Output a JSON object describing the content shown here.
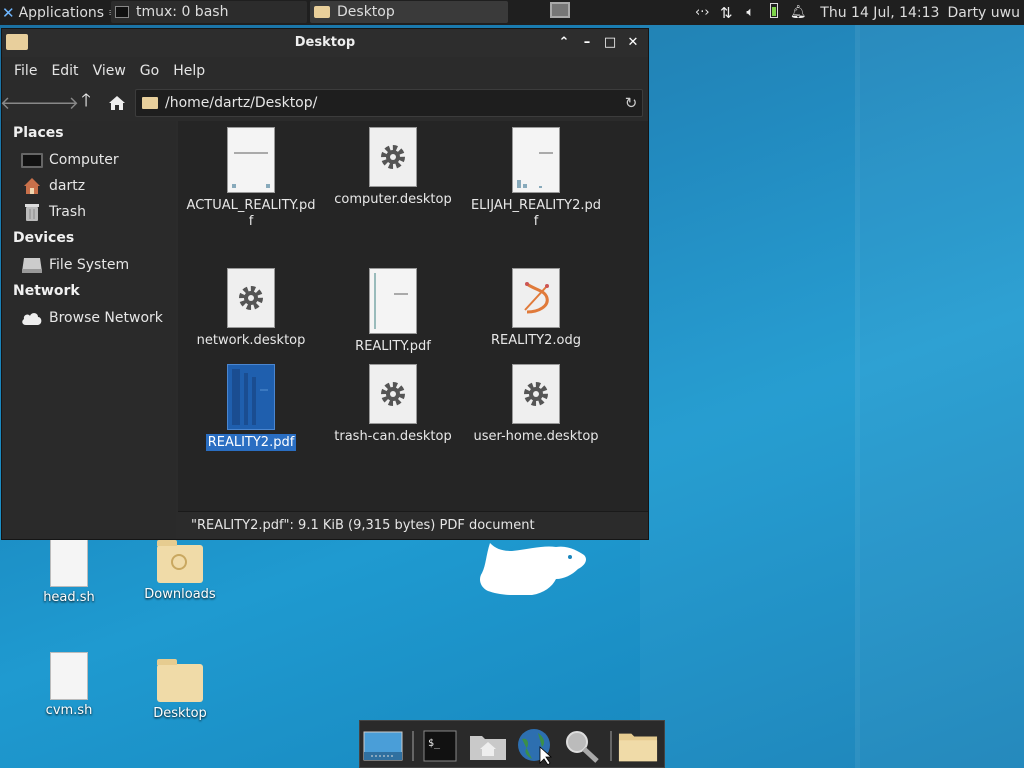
{
  "top_panel": {
    "applications_label": "Applications",
    "tasks": [
      {
        "label": "tmux: 0 bash",
        "icon": "terminal-icon"
      },
      {
        "label": "Desktop",
        "icon": "folder-icon"
      }
    ],
    "clock": "Thu 14 Jul, 14:13",
    "user": "Darty uwu"
  },
  "window": {
    "title": "Desktop",
    "menu": [
      "File",
      "Edit",
      "View",
      "Go",
      "Help"
    ],
    "location": "/home/dartz/Desktop/",
    "sidebar": {
      "places_heading": "Places",
      "places": [
        "Computer",
        "dartz",
        "Trash"
      ],
      "devices_heading": "Devices",
      "devices": [
        "File System"
      ],
      "network_heading": "Network",
      "network": [
        "Browse Network"
      ]
    },
    "files": [
      {
        "name": "ACTUAL_REALITY.pdf",
        "type": "pdf"
      },
      {
        "name": "computer.desktop",
        "type": "desktop"
      },
      {
        "name": "ELIJAH_REALITY2.pdf",
        "type": "pdf"
      },
      {
        "name": "network.desktop",
        "type": "desktop"
      },
      {
        "name": "REALITY.pdf",
        "type": "pdf"
      },
      {
        "name": "REALITY2.odg",
        "type": "odg"
      },
      {
        "name": "REALITY2.pdf",
        "type": "pdf",
        "selected": true
      },
      {
        "name": "trash-can.desktop",
        "type": "desktop"
      },
      {
        "name": "user-home.desktop",
        "type": "desktop"
      }
    ],
    "status": "\"REALITY2.pdf\": 9.1 KiB (9,315 bytes) PDF document"
  },
  "desktop_icons": [
    {
      "name": "head.sh",
      "type": "script"
    },
    {
      "name": "Downloads",
      "type": "folder"
    },
    {
      "name": "cvm.sh",
      "type": "script"
    },
    {
      "name": "Desktop",
      "type": "folder"
    }
  ],
  "colors": {
    "selection": "#2a6ec2",
    "panel": "#1f1f1f",
    "window_bg": "#2b2b2b",
    "folder": "#e8cf9c"
  }
}
